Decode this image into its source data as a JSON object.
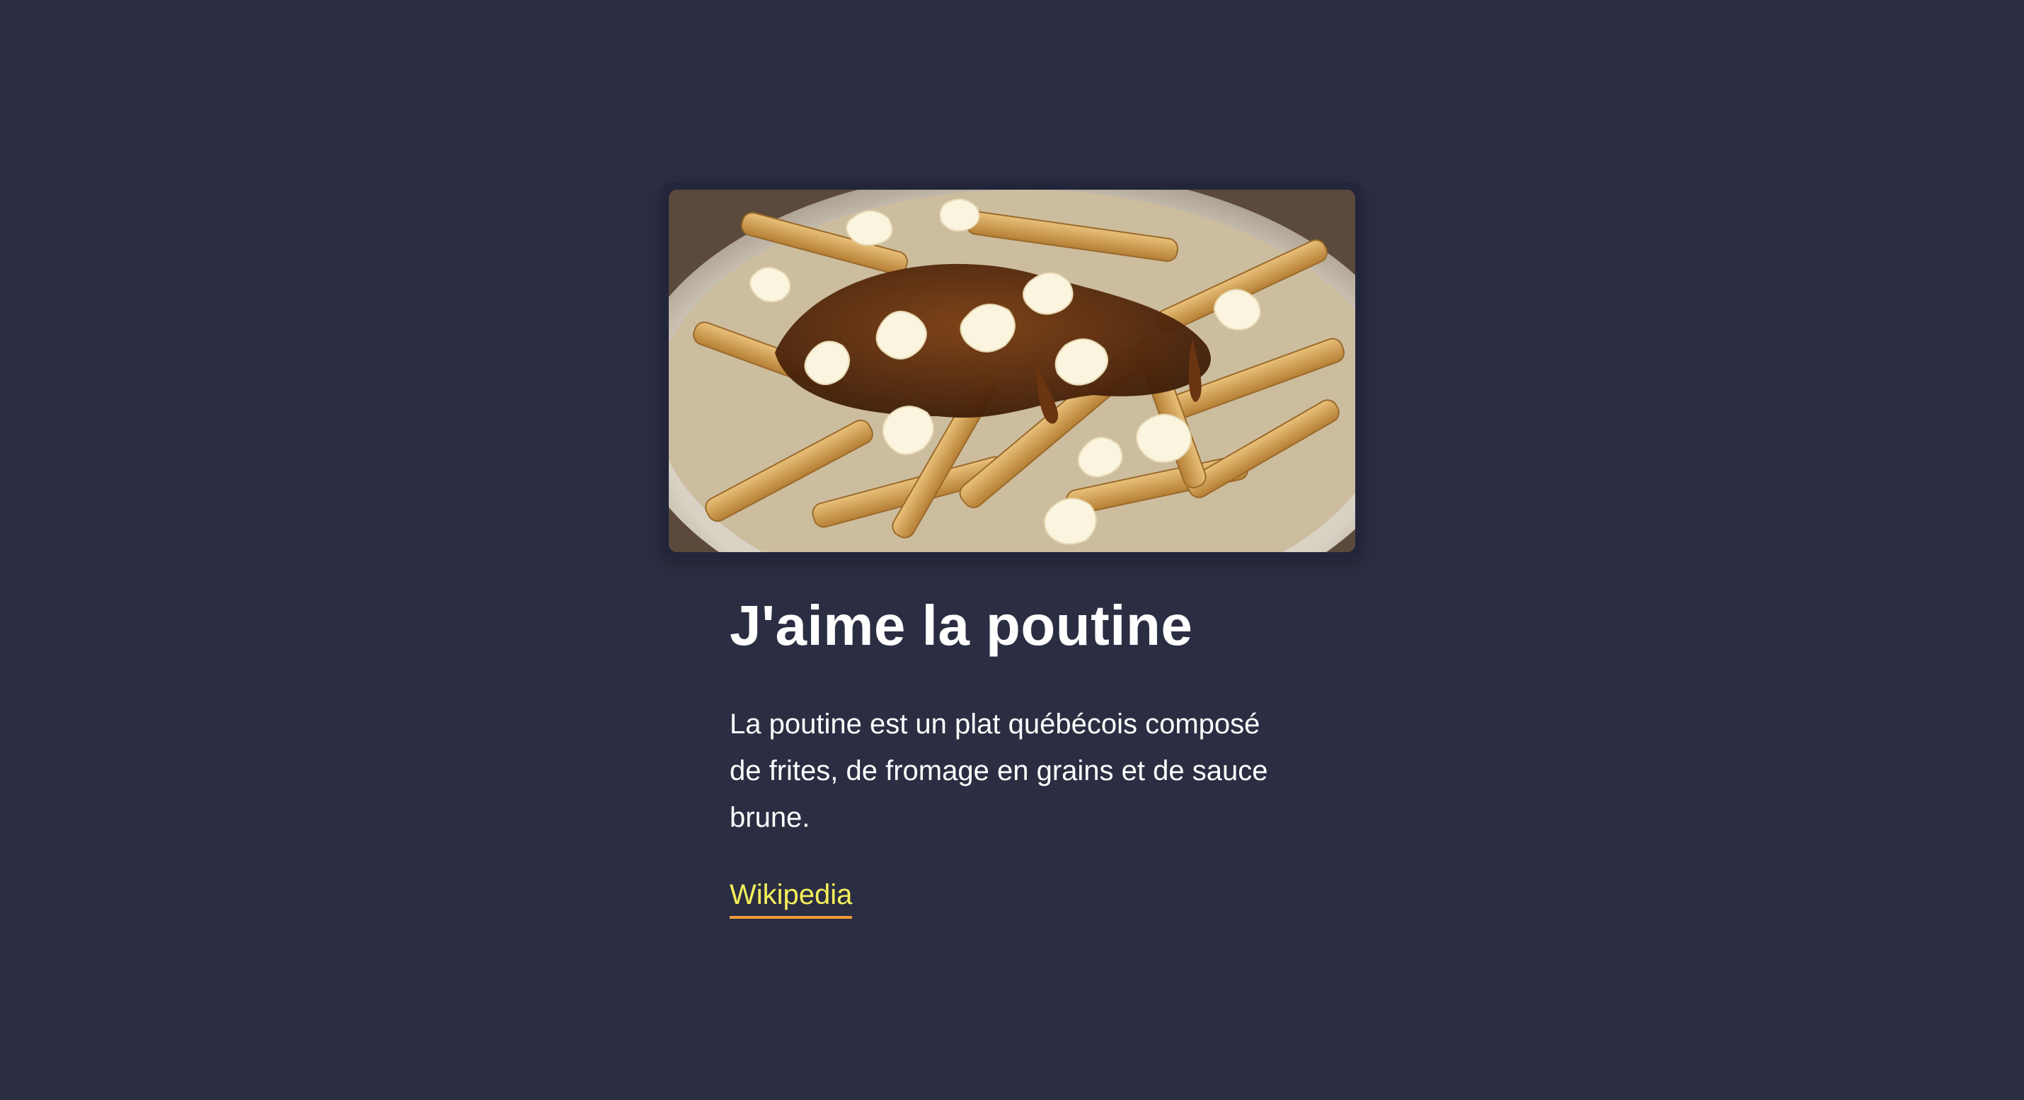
{
  "card": {
    "title": "J'aime la poutine",
    "description": "La poutine est un plat québécois composé de frites, de fromage en grains et de sauce brune.",
    "link_label": "Wikipedia"
  },
  "colors": {
    "background": "#2b2d42",
    "text": "#ffffff",
    "link": "#f5ef5b",
    "link_underline": "#f29b3a"
  }
}
